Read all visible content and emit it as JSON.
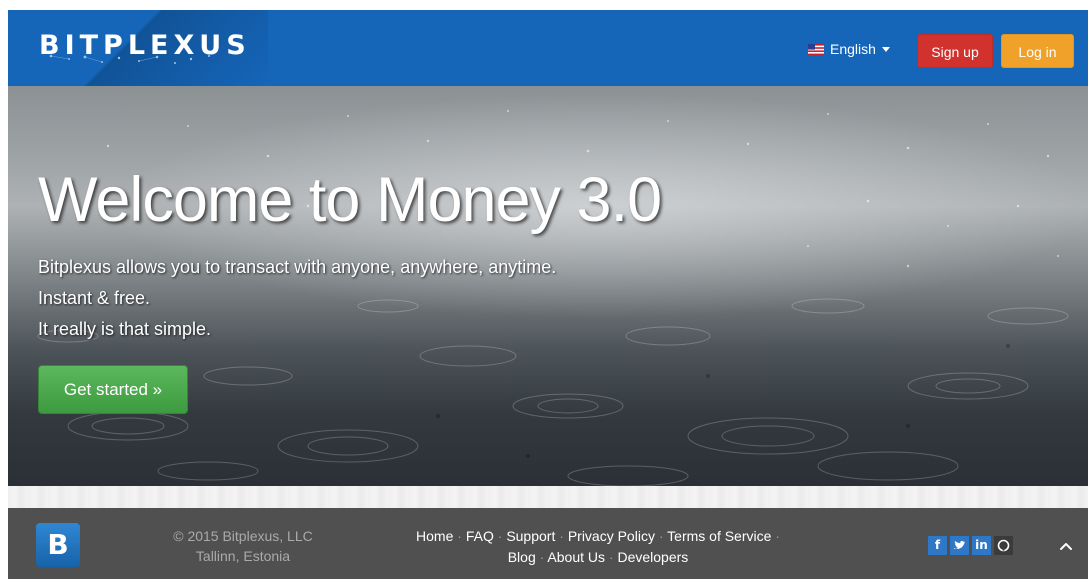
{
  "navbar": {
    "brand": "BITPLEXUS",
    "language": "English",
    "signup_label": "Sign up",
    "login_label": "Log in",
    "bg_color": "#1565b9",
    "signup_color": "#d2322d",
    "login_color": "#f0a12a"
  },
  "hero": {
    "title": "Welcome to Money 3.0",
    "lines": [
      "Bitplexus allows you to transact with anyone, anywhere, anytime.",
      "Instant & free.",
      "It really is that simple."
    ],
    "cta_label": "Get started »",
    "cta_color": "#4cae4c"
  },
  "footer": {
    "logo_letter": "B",
    "copyright": "© 2015 Bitplexus, LLC",
    "location": "Tallinn, Estonia",
    "links_row1": [
      "Home",
      "FAQ",
      "Support",
      "Privacy Policy",
      "Terms of Service"
    ],
    "links_row2": [
      "Blog",
      "About Us",
      "Developers"
    ],
    "social_icons": [
      "facebook-icon",
      "twitter-icon",
      "linkedin-icon",
      "github-icon"
    ],
    "to_top_icon": "chevron-up-icon",
    "bg_color": "#505050"
  }
}
